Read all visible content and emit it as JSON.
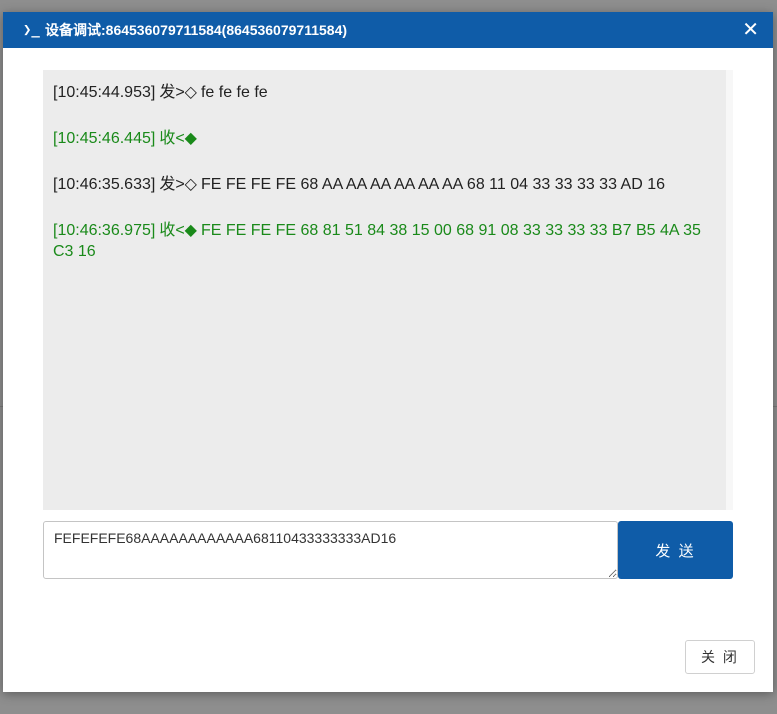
{
  "dialog": {
    "title_icon": "❯_",
    "title": "设备调试:864536079711584(864536079711584)",
    "close_glyph": "✕"
  },
  "log": [
    {
      "type": "send",
      "time": "[10:45:44.953]",
      "prefix": "发>◇",
      "data": "fe fe fe fe"
    },
    {
      "type": "recv",
      "time": "[10:45:46.445]",
      "prefix": "收<◆",
      "data": ""
    },
    {
      "type": "send",
      "time": "[10:46:35.633]",
      "prefix": "发>◇",
      "data": "FE FE FE FE 68 AA AA AA AA AA AA 68 11 04 33 33 33 33 AD 16"
    },
    {
      "type": "recv",
      "time": "[10:46:36.975]",
      "prefix": "收<◆",
      "data": "FE FE FE FE 68 81 51 84 38 15 00 68 91 08 33 33 33 33 B7 B5 4A 35 C3 16"
    }
  ],
  "input": {
    "value": "FEFEFEFE68AAAAAAAAAAAA68110433333333AD16"
  },
  "buttons": {
    "send": "发 送",
    "close": "关 闭"
  },
  "colors": {
    "titlebar": "#0f5ca8",
    "send_text": "#222222",
    "recv_text": "#1a8a1a",
    "log_bg": "#ececec"
  }
}
